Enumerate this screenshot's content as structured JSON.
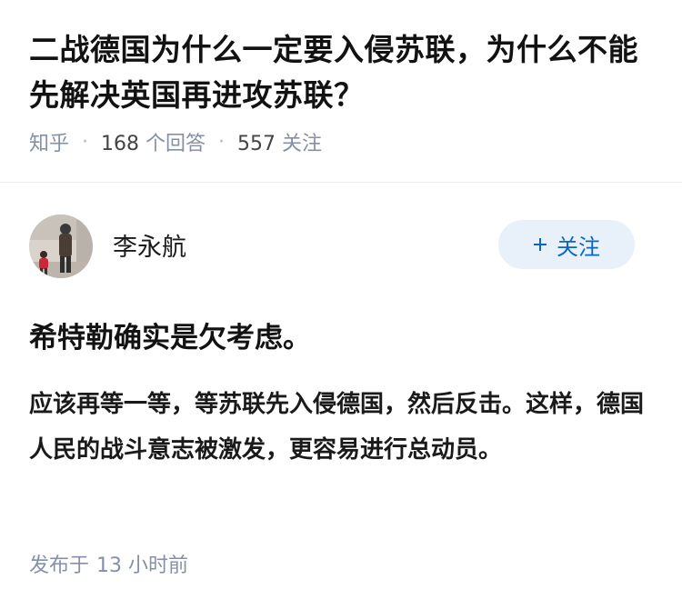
{
  "question": {
    "title": "二战德国为什么一定要入侵苏联，为什么不能先解决英国再进攻苏联？",
    "source": "知乎",
    "answer_count": "168",
    "answer_count_label": "个回答",
    "follower_count": "557",
    "follower_count_label": "关注"
  },
  "author": {
    "name": "李永航",
    "follow_label": "关注",
    "follow_icon": "plus-icon"
  },
  "answer": {
    "lead": "希特勒确实是欠考虑。",
    "body": "应该再等一等，等苏联先入侵德国，然后反击。这样，德国人民的战斗意志被激发，更容易进行总动员。"
  },
  "footer": {
    "published_label": "发布于",
    "published_time": "13 小时前"
  },
  "colors": {
    "accent": "#0a66c2",
    "follow_bg": "#e8f0fa",
    "meta_text": "#8590a6"
  }
}
